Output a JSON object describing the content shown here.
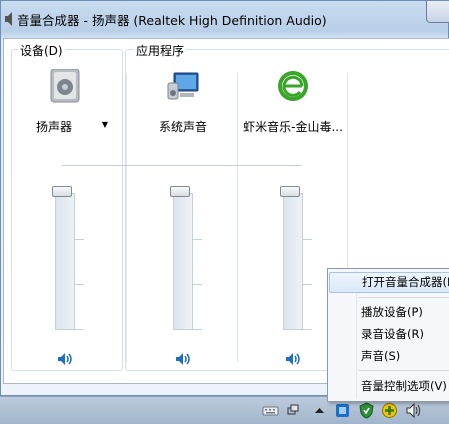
{
  "window": {
    "title": "音量合成器 - 扬声器 (Realtek High Definition Audio)"
  },
  "device_group": {
    "label": "设备(D)",
    "device": {
      "name": "扬声器",
      "icon": "speaker-device-icon",
      "volume_percent": 100
    }
  },
  "apps_group": {
    "label": "应用程序",
    "apps": [
      {
        "name": "系统声音",
        "icon": "system-sounds-icon",
        "volume_percent": 100
      },
      {
        "name": "虾米音乐-金山毒...",
        "icon": "xiami-music-icon",
        "volume_percent": 100
      }
    ]
  },
  "context_menu": {
    "items": [
      {
        "label": "打开音量合成器(M)",
        "highlighted": true
      },
      {
        "label": "播放设备(P)"
      },
      {
        "label": "录音设备(R)"
      },
      {
        "label": "声音(S)"
      },
      {
        "label": "音量控制选项(V)"
      }
    ]
  },
  "colors": {
    "accent": "#1e6fbf",
    "xiami_green": "#3aa629"
  }
}
